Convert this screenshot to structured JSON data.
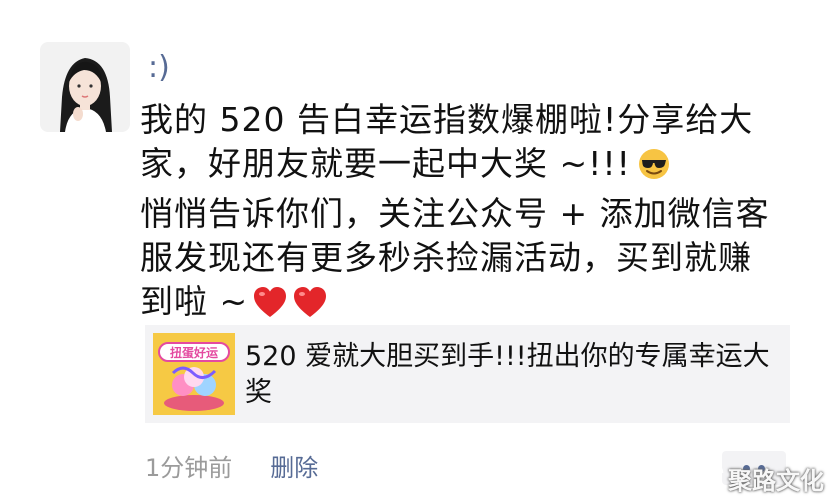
{
  "post": {
    "nickname": ":)",
    "lines": [
      "我的 520 告白幸运指数爆棚啦!分享给大",
      "家，好朋友就要一起中大奖 ~!!!",
      "悄悄告诉你们，关注公众号 + 添加微信客",
      "服发现还有更多秒杀捡漏活动，买到就赚",
      "到啦 ~"
    ],
    "emoji": "sunglasses-emoji",
    "hearts": [
      "red-heart-emoji",
      "red-heart-emoji"
    ]
  },
  "link_card": {
    "thumbnail_text": "扭蛋好运",
    "title": "520 爱就大胆买到手!!!扭出你的专属幸运大奖"
  },
  "footer": {
    "time": "1分钟前",
    "delete_label": "删除"
  },
  "watermark": {
    "text": "聚路文化"
  },
  "colors": {
    "link_blue": "#576b95",
    "gray_text": "#9b9b9b",
    "card_bg": "#f3f3f5"
  }
}
